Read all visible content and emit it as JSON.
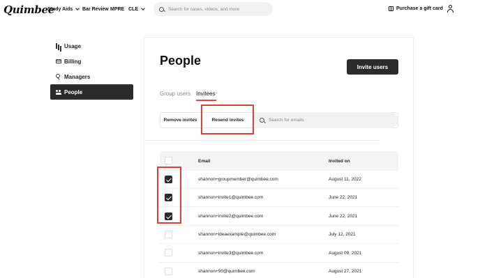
{
  "header": {
    "logo": "Quimbee",
    "nav": [
      {
        "label": "Study Aids",
        "dropdown": true
      },
      {
        "label": "Bar Review",
        "dropdown": false
      },
      {
        "label": "MPRE",
        "dropdown": false
      },
      {
        "label": "CLE",
        "dropdown": true
      }
    ],
    "search_placeholder": "Search for cases, videos, and more",
    "gift_label": "Purchase a gift card"
  },
  "sidebar": {
    "items": [
      {
        "label": "Usage",
        "icon": "bar-chart-icon",
        "active": false
      },
      {
        "label": "Billing",
        "icon": "credit-card-icon",
        "active": false
      },
      {
        "label": "Managers",
        "icon": "key-icon",
        "active": false
      },
      {
        "label": "People",
        "icon": "people-icon",
        "active": true
      }
    ]
  },
  "main": {
    "title": "People",
    "invite_button": "Invite users",
    "tabs": [
      {
        "label": "Group users",
        "active": false
      },
      {
        "label": "Invitees",
        "active": true
      }
    ],
    "actions": {
      "remove": "Remove invites",
      "resend": "Resend invites",
      "email_search_placeholder": "Search for emails"
    },
    "table": {
      "columns": [
        "Email",
        "Invited on"
      ],
      "rows": [
        {
          "email": "shannon+groupmember@quimbee.com",
          "invited_on": "August 11, 2022",
          "checked": true
        },
        {
          "email": "shannon+invite1@quimbee.com",
          "invited_on": "June 22, 2021",
          "checked": true
        },
        {
          "email": "shannon+invite2@quimbee.com",
          "invited_on": "June 22, 2021",
          "checked": true
        },
        {
          "email": "shannon+ideaexample@quimbee.com",
          "invited_on": "July 12, 2021",
          "checked": false
        },
        {
          "email": "shannon+invite3@quimbee.com",
          "invited_on": "August 09, 2021",
          "checked": false
        },
        {
          "email": "shannon+90@quimbee.com",
          "invited_on": "August 27, 2021",
          "checked": false
        }
      ]
    }
  },
  "colors": {
    "accent": "#d94b3a",
    "highlight": "#d64333",
    "dark_button": "#2b2b2b"
  }
}
